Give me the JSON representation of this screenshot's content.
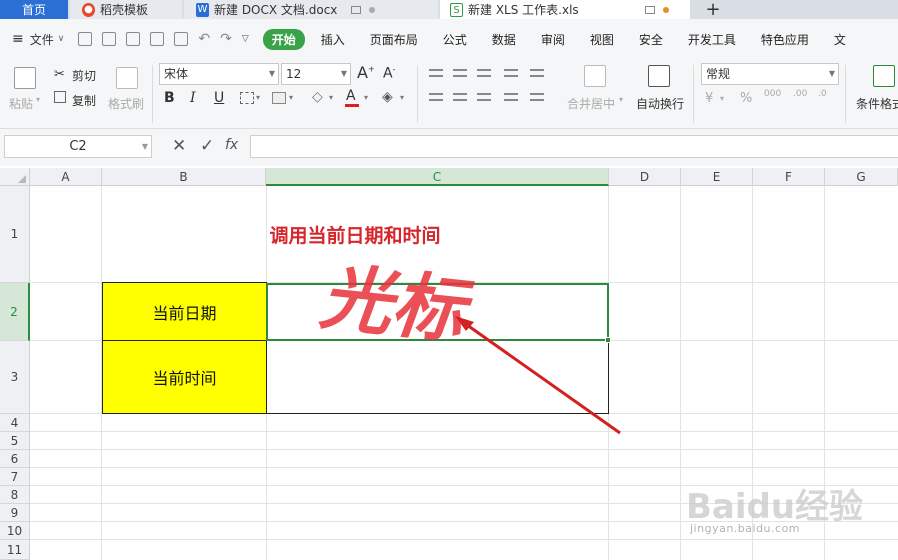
{
  "tabs": [
    {
      "label": "首页",
      "active": false
    },
    {
      "label": "稻壳模板",
      "icon": "docer-icon"
    },
    {
      "label": "新建 DOCX 文档.docx",
      "icon": "word-doc-icon"
    },
    {
      "label": "新建 XLS 工作表.xls",
      "icon": "spreadsheet-icon",
      "active": true
    }
  ],
  "menu": {
    "file": "文件",
    "items": [
      "开始",
      "插入",
      "页面布局",
      "公式",
      "数据",
      "审阅",
      "视图",
      "安全",
      "开发工具",
      "特色应用",
      "文"
    ]
  },
  "ribbon": {
    "paste": "粘贴",
    "cut": "剪切",
    "copy": "复制",
    "format_painter": "格式刷",
    "font_name": "宋体",
    "font_size": "12",
    "merge_center": "合并居中",
    "wrap_text": "自动换行",
    "number_format": "常规",
    "conditional_format": "条件格式",
    "font_color": "#e02020"
  },
  "formula_bar": {
    "name_box": "C2",
    "fx": "fx",
    "content": ""
  },
  "grid": {
    "columns": [
      "A",
      "B",
      "C",
      "D",
      "E",
      "F",
      "G"
    ],
    "active_column": "C",
    "rows": [
      "1",
      "2",
      "3",
      "4",
      "5",
      "6",
      "7",
      "8",
      "9",
      "10",
      "11"
    ],
    "active_row": "2",
    "cells": {
      "title": "调用当前日期和时间",
      "b2": "当前日期",
      "b3": "当前时间",
      "c2": "",
      "c3": ""
    }
  },
  "annotation": {
    "text": "光标",
    "color": "#e8323a"
  },
  "watermark": {
    "brand": "Baidu经验",
    "url": "jingyan.baidu.com"
  }
}
